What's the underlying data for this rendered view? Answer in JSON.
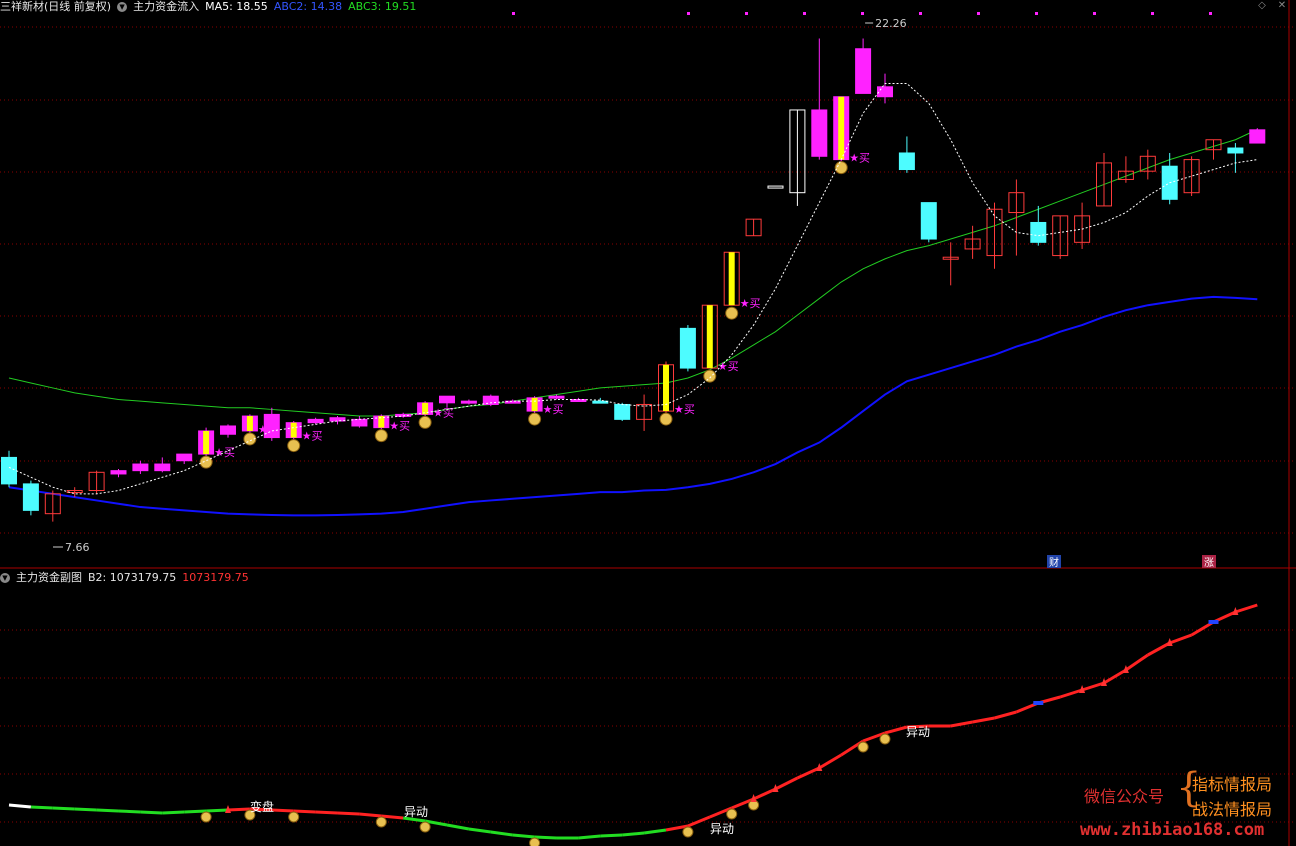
{
  "header": {
    "stock_title": "三祥新材(日线 前复权)",
    "indicator_name": "主力资金流入",
    "ma5": "MA5: 18.55",
    "abc2": "ABC2: 14.38",
    "abc3": "ABC3: 19.51"
  },
  "sub_header": {
    "indicator_name": "主力资金副图",
    "b2_label": "B2: 1073179.75",
    "b2_value": "1073179.75"
  },
  "annotations": {
    "high_price": "22.26",
    "low_price": "7.66",
    "buy": "买",
    "finance_badge": "财",
    "rise_badge": "涨",
    "change_label": "变盘",
    "abnormal_label": "异动"
  },
  "watermark": {
    "wechat": "微信公众号",
    "brace": "{",
    "line1": "指标情报局",
    "line2": "战法情报局",
    "url": "www.zhibiao168.com"
  },
  "colors": {
    "up": "#ff3b3b",
    "down": "#4dfcff",
    "magenta": "#ff22ff",
    "yellow": "#ffff00",
    "ma_white": "#ffffff",
    "abc2_blue": "#1111ff",
    "abc3_green": "#22cc22",
    "grid": "#8a0000"
  },
  "chart_data": {
    "type": "candlestick",
    "price_range": [
      6.5,
      23.0
    ],
    "candles": [
      {
        "o": 9.6,
        "h": 9.8,
        "l": 8.7,
        "c": 8.8,
        "type": "down"
      },
      {
        "o": 8.8,
        "h": 8.9,
        "l": 7.85,
        "c": 8.0,
        "type": "down"
      },
      {
        "o": 7.9,
        "h": 8.6,
        "l": 7.66,
        "c": 8.5,
        "type": "up"
      },
      {
        "o": 8.6,
        "h": 8.7,
        "l": 8.4,
        "c": 8.55,
        "type": "up"
      },
      {
        "o": 8.6,
        "h": 9.2,
        "l": 8.5,
        "c": 9.15,
        "type": "up"
      },
      {
        "o": 9.1,
        "h": 9.25,
        "l": 9.0,
        "c": 9.2,
        "type": "mag"
      },
      {
        "o": 9.2,
        "h": 9.5,
        "l": 9.1,
        "c": 9.4,
        "type": "mag"
      },
      {
        "o": 9.4,
        "h": 9.6,
        "l": 9.15,
        "c": 9.2,
        "type": "mag"
      },
      {
        "o": 9.5,
        "h": 9.6,
        "l": 9.4,
        "c": 9.7,
        "type": "mag"
      },
      {
        "o": 9.7,
        "h": 10.5,
        "l": 9.5,
        "c": 10.4,
        "type": "mag-buy"
      },
      {
        "o": 10.3,
        "h": 10.6,
        "l": 10.2,
        "c": 10.55,
        "type": "mag"
      },
      {
        "o": 10.4,
        "h": 10.9,
        "l": 10.3,
        "c": 10.85,
        "type": "mag-buy"
      },
      {
        "o": 10.9,
        "h": 11.1,
        "l": 10.1,
        "c": 10.2,
        "type": "mag"
      },
      {
        "o": 10.2,
        "h": 10.7,
        "l": 10.0,
        "c": 10.65,
        "type": "mag-buy"
      },
      {
        "o": 10.65,
        "h": 10.8,
        "l": 10.6,
        "c": 10.75,
        "type": "mag"
      },
      {
        "o": 10.7,
        "h": 10.85,
        "l": 10.6,
        "c": 10.8,
        "type": "mag"
      },
      {
        "o": 10.75,
        "h": 10.85,
        "l": 10.5,
        "c": 10.55,
        "type": "mag"
      },
      {
        "o": 10.5,
        "h": 10.9,
        "l": 10.4,
        "c": 10.85,
        "type": "mag-buy"
      },
      {
        "o": 10.85,
        "h": 10.95,
        "l": 10.8,
        "c": 10.9,
        "type": "mag"
      },
      {
        "o": 10.9,
        "h": 11.3,
        "l": 10.85,
        "c": 11.25,
        "type": "mag-buy"
      },
      {
        "o": 11.25,
        "h": 11.45,
        "l": 11.1,
        "c": 11.45,
        "type": "mag"
      },
      {
        "o": 11.3,
        "h": 11.35,
        "l": 11.2,
        "c": 11.3,
        "type": "mag"
      },
      {
        "o": 11.2,
        "h": 11.5,
        "l": 11.15,
        "c": 11.45,
        "type": "mag"
      },
      {
        "o": 11.3,
        "h": 11.35,
        "l": 11.25,
        "c": 11.3,
        "type": "mag"
      },
      {
        "o": 11.0,
        "h": 11.45,
        "l": 10.9,
        "c": 11.4,
        "type": "mag-buy"
      },
      {
        "o": 11.4,
        "h": 11.5,
        "l": 11.35,
        "c": 11.45,
        "type": "mag"
      },
      {
        "o": 11.35,
        "h": 11.4,
        "l": 11.3,
        "c": 11.35,
        "type": "mag"
      },
      {
        "o": 11.3,
        "h": 11.4,
        "l": 11.25,
        "c": 11.3,
        "type": "down"
      },
      {
        "o": 11.2,
        "h": 11.25,
        "l": 10.7,
        "c": 10.75,
        "type": "down"
      },
      {
        "o": 10.75,
        "h": 11.5,
        "l": 10.4,
        "c": 11.2,
        "type": "up"
      },
      {
        "o": 11.0,
        "h": 12.5,
        "l": 10.9,
        "c": 12.4,
        "type": "up-buy"
      },
      {
        "o": 12.3,
        "h": 13.6,
        "l": 12.2,
        "c": 13.5,
        "type": "down"
      },
      {
        "o": 12.3,
        "h": 14.2,
        "l": 12.3,
        "c": 14.2,
        "type": "up-buy"
      },
      {
        "o": 14.2,
        "h": 15.8,
        "l": 14.2,
        "c": 15.8,
        "type": "up-buy"
      },
      {
        "o": 16.3,
        "h": 16.8,
        "l": 16.3,
        "c": 16.8,
        "type": "up"
      },
      {
        "o": 17.8,
        "h": 17.8,
        "l": 17.8,
        "c": 17.8,
        "type": "flat"
      },
      {
        "o": 17.6,
        "h": 20.1,
        "l": 17.2,
        "c": 20.1,
        "type": "flat"
      },
      {
        "o": 18.7,
        "h": 22.26,
        "l": 18.6,
        "c": 20.1,
        "type": "mag"
      },
      {
        "o": 18.6,
        "h": 20.5,
        "l": 18.4,
        "c": 20.5,
        "type": "mag-buy"
      },
      {
        "o": 20.6,
        "h": 22.26,
        "l": 20.6,
        "c": 21.95,
        "type": "mag"
      },
      {
        "o": 20.5,
        "h": 21.2,
        "l": 20.3,
        "c": 20.8,
        "type": "mag"
      },
      {
        "o": 18.8,
        "h": 19.3,
        "l": 18.2,
        "c": 18.3,
        "type": "down"
      },
      {
        "o": 17.3,
        "h": 17.3,
        "l": 16.1,
        "c": 16.2,
        "type": "down"
      },
      {
        "o": 15.6,
        "h": 16.1,
        "l": 14.8,
        "c": 15.65,
        "type": "up"
      },
      {
        "o": 15.9,
        "h": 16.6,
        "l": 15.6,
        "c": 16.2,
        "type": "up"
      },
      {
        "o": 15.7,
        "h": 17.3,
        "l": 15.3,
        "c": 17.1,
        "type": "up"
      },
      {
        "o": 17.0,
        "h": 18.0,
        "l": 15.7,
        "c": 17.6,
        "type": "up"
      },
      {
        "o": 16.7,
        "h": 17.2,
        "l": 16.0,
        "c": 16.1,
        "type": "down"
      },
      {
        "o": 15.7,
        "h": 16.9,
        "l": 15.6,
        "c": 16.9,
        "type": "up"
      },
      {
        "o": 16.1,
        "h": 17.3,
        "l": 15.9,
        "c": 16.9,
        "type": "up"
      },
      {
        "o": 17.2,
        "h": 18.8,
        "l": 17.2,
        "c": 18.5,
        "type": "up"
      },
      {
        "o": 18.0,
        "h": 18.7,
        "l": 17.9,
        "c": 18.25,
        "type": "up"
      },
      {
        "o": 18.25,
        "h": 18.9,
        "l": 18.0,
        "c": 18.7,
        "type": "up"
      },
      {
        "o": 18.4,
        "h": 18.8,
        "l": 17.25,
        "c": 17.4,
        "type": "down"
      },
      {
        "o": 17.6,
        "h": 18.7,
        "l": 17.5,
        "c": 18.6,
        "type": "up"
      },
      {
        "o": 18.9,
        "h": 19.2,
        "l": 18.6,
        "c": 19.2,
        "type": "up"
      },
      {
        "o": 18.95,
        "h": 19.1,
        "l": 18.2,
        "c": 18.8,
        "type": "down"
      },
      {
        "o": 19.1,
        "h": 19.55,
        "l": 19.1,
        "c": 19.5,
        "type": "mag"
      }
    ],
    "ma5": [
      9.3,
      9.0,
      8.7,
      8.5,
      8.5,
      8.6,
      8.8,
      9.0,
      9.2,
      9.5,
      9.8,
      10.1,
      10.4,
      10.5,
      10.6,
      10.7,
      10.75,
      10.8,
      10.85,
      10.95,
      11.05,
      11.15,
      11.25,
      11.3,
      11.3,
      11.35,
      11.35,
      11.33,
      11.2,
      11.15,
      11.2,
      11.5,
      12.0,
      12.7,
      13.6,
      14.7,
      16.0,
      17.3,
      18.6,
      20.0,
      20.9,
      20.9,
      20.3,
      19.2,
      17.9,
      16.9,
      16.4,
      16.3,
      16.4,
      16.5,
      16.7,
      17.0,
      17.5,
      17.9,
      18.1,
      18.3,
      18.5,
      18.6
    ],
    "abc2": [
      8.7,
      8.6,
      8.5,
      8.4,
      8.3,
      8.2,
      8.1,
      8.05,
      8.0,
      7.95,
      7.9,
      7.88,
      7.86,
      7.85,
      7.85,
      7.86,
      7.88,
      7.9,
      7.95,
      8.05,
      8.15,
      8.25,
      8.3,
      8.35,
      8.4,
      8.45,
      8.5,
      8.55,
      8.55,
      8.6,
      8.62,
      8.7,
      8.8,
      8.95,
      9.15,
      9.4,
      9.75,
      10.05,
      10.5,
      11.0,
      11.5,
      11.9,
      12.1,
      12.3,
      12.5,
      12.7,
      12.95,
      13.15,
      13.4,
      13.6,
      13.85,
      14.05,
      14.2,
      14.3,
      14.4,
      14.45,
      14.42,
      14.38
    ],
    "abc3": [
      12.0,
      11.85,
      11.7,
      11.55,
      11.45,
      11.35,
      11.3,
      11.25,
      11.2,
      11.15,
      11.1,
      11.1,
      11.05,
      11.0,
      10.95,
      10.9,
      10.85,
      10.85,
      10.9,
      10.95,
      11.05,
      11.15,
      11.2,
      11.3,
      11.4,
      11.5,
      11.6,
      11.7,
      11.75,
      11.8,
      11.85,
      12.0,
      12.25,
      12.6,
      13.0,
      13.4,
      13.9,
      14.4,
      14.9,
      15.3,
      15.6,
      15.85,
      16.0,
      16.2,
      16.4,
      16.6,
      16.85,
      17.1,
      17.35,
      17.6,
      17.85,
      18.1,
      18.35,
      18.6,
      18.8,
      19.0,
      19.2,
      19.51
    ],
    "b2_curve": [
      805,
      807,
      808,
      809,
      810,
      811,
      812,
      813,
      812,
      811,
      810,
      809,
      810,
      811,
      812,
      813,
      814,
      816,
      818,
      821,
      825,
      829,
      832,
      835,
      837,
      838,
      838,
      836,
      835,
      833,
      830,
      826,
      817,
      808,
      799,
      789,
      778,
      768,
      755,
      741,
      733,
      727,
      726,
      726,
      722,
      718,
      712,
      703,
      697,
      690,
      683,
      670,
      655,
      643,
      635,
      622,
      612,
      605
    ]
  }
}
